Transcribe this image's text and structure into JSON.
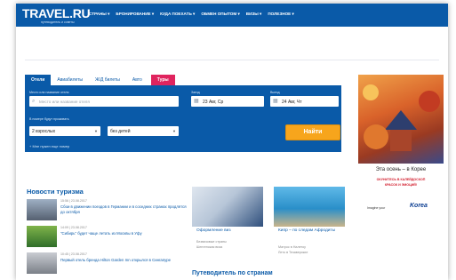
{
  "brand": {
    "logo": "TRAVEL.RU",
    "tagline": "путеводитель и советы"
  },
  "nav": [
    "СТРАНЫ ▾",
    "БРОНИРОВАНИЕ ▾",
    "КУДА ПОЕХАТЬ ▾",
    "ОБМЕН ОПЫТОМ ▾",
    "ВИЗЫ ▾",
    "ПОЛЕЗНОЕ ▾"
  ],
  "search": {
    "tabs": [
      "Отели",
      "Авиабилеты",
      "Ж/Д билеты",
      "Авто",
      "Туры"
    ],
    "active_tab": "Отели",
    "hotel_label": "Место или название отеля",
    "hotel_placeholder": "Место или название отеля",
    "checkin_label": "Заезд",
    "checkin_value": "23 Авг, Ср",
    "checkout_label": "Выезд",
    "checkout_value": "24 Авг, Чт",
    "guests_label": "В номере будут проживать",
    "adults_value": "2 взрослых",
    "children_value": "без детей",
    "submit_label": "Найти",
    "more_rooms": "+ Мне нужен еще номер"
  },
  "ad": {
    "title": "Эта осень – в Корее",
    "line1": "ОКУНИТЕСЬ В КАЛЕЙДОСКОП",
    "line2": "КРАСОК И ЭМОЦИЙ!",
    "footer": "Imagine your",
    "brand": "Korea"
  },
  "news": {
    "title": "Новости туризма",
    "items": [
      {
        "date": "15:56 | 23.08.2017",
        "text": "Сбои в движении поездов в Германии и в соседних странах продлятся до октября"
      },
      {
        "date": "14:09 | 23.08.2017",
        "text": "\"Сибирь\" будет чаще летать из Москвы в Уфу"
      },
      {
        "date": "10:45 | 23.08.2017",
        "text": "Первый отель бренда Hilton Garden Inn открылся в Сингапуре"
      }
    ]
  },
  "promos": [
    {
      "title": "Оформление виз",
      "lines": [
        "Безвизовые страны",
        "Шенгенская виза"
      ]
    },
    {
      "title": "Кипр – по следам Афродиты",
      "lines": [
        "Матрос в Налетоу",
        "Лето в Тезаверские"
      ]
    }
  ],
  "guide_title": "Путеводитель по странам"
}
